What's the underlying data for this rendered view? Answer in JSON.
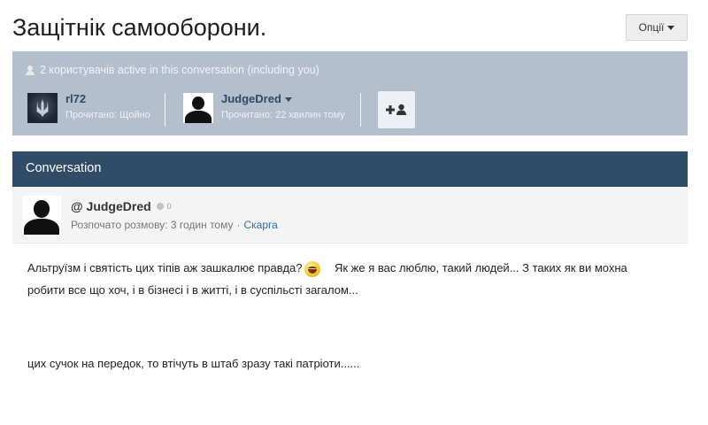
{
  "page": {
    "title": "Защітнік самооборони.",
    "options_label": "Опції"
  },
  "participants": {
    "header": "2 користувачів active in this conversation (including you)",
    "members": [
      {
        "name": "rl72",
        "seen": "Прочитано: Щойно"
      },
      {
        "name": "JudgeDred",
        "seen": "Прочитано: 22 хвилин тому"
      }
    ]
  },
  "conversation": {
    "bar_title": "Conversation",
    "post": {
      "author": "@ JudgeDred",
      "reputation": "0",
      "started": "Розпочато розмову: 3 годин тому",
      "separator": "·",
      "report_label": "Скарга",
      "body_line_1a": "Альтруїзм і святість цих тіпів аж зашкалює правда?",
      "body_line_1b": "Як же я вас люблю, такий людей... З таких як ви мохна",
      "body_line_2": "робити все що хоч, і в бізнесі і в житті, і в суспільсті загалом...",
      "body_line_3": "цих сучок на передок,  то втічуть в штаб зразу такі патріоти......"
    }
  },
  "icons": [
    "user-icon",
    "caret-down-icon",
    "add-user-icon",
    "smiley-icon",
    "reputation-dot-icon"
  ],
  "colors": {
    "participants_bg": "#b3bfcd",
    "conversation_bar": "#2f4d66",
    "link": "#2d6ca2",
    "member_name": "#2e4a66"
  }
}
